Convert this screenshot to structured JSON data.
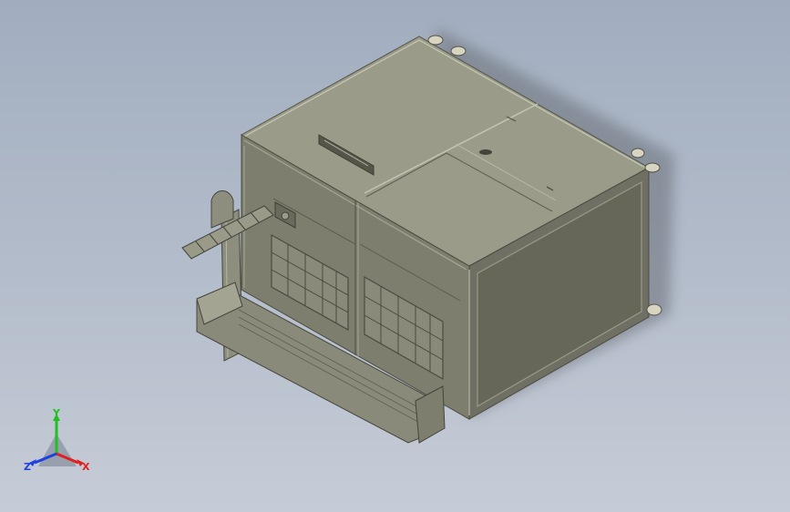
{
  "triad": {
    "x_label": "X",
    "y_label": "Y",
    "z_label": "Z"
  },
  "colors": {
    "background_top": "#a1adbf",
    "background_bottom": "#c6ccd7",
    "body_top": "#9a9a88",
    "body_front": "#7e7e6e",
    "body_side": "#6e6e62",
    "axis_x": "#e02020",
    "axis_y": "#20c020",
    "axis_z": "#2040e0"
  }
}
